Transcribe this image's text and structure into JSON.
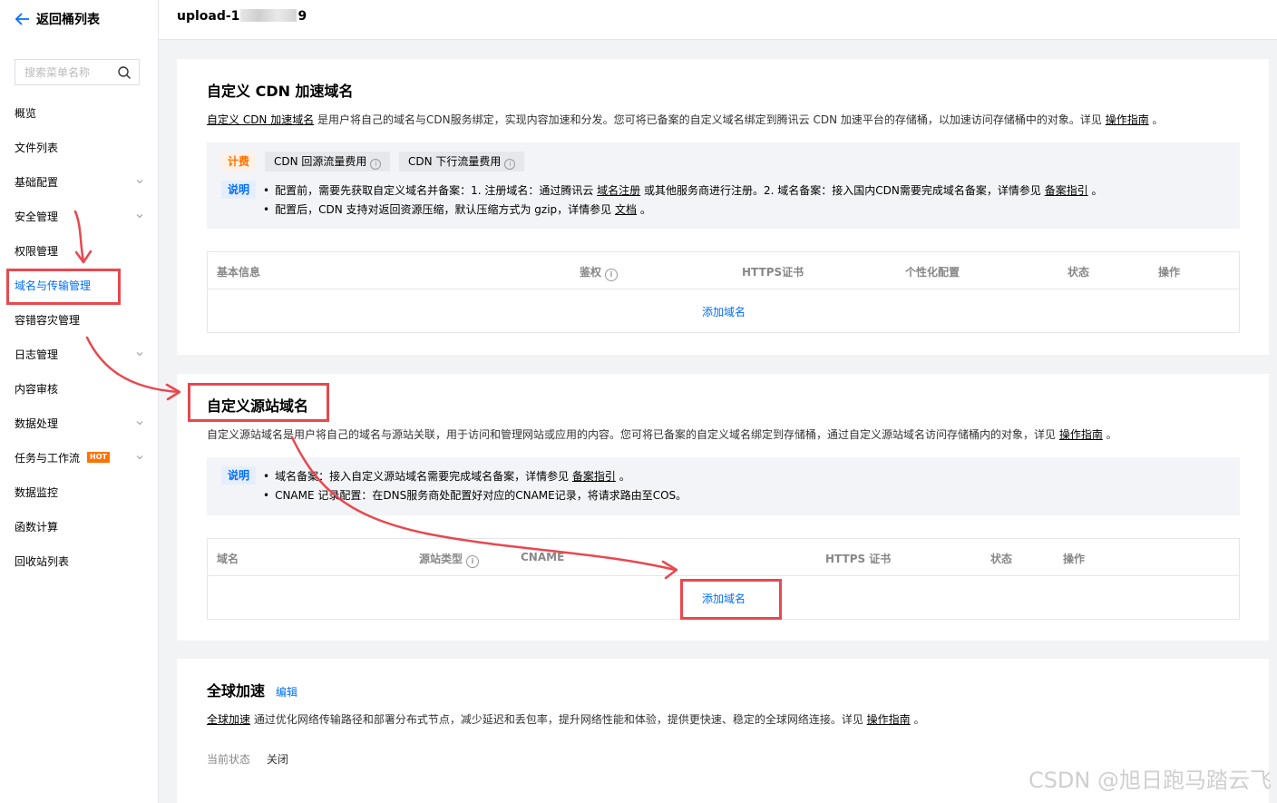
{
  "sidebar": {
    "back_label": "返回桶列表",
    "search_placeholder": "搜索菜单名称",
    "items": [
      {
        "label": "概览"
      },
      {
        "label": "文件列表"
      },
      {
        "label": "基础配置"
      },
      {
        "label": "安全管理"
      },
      {
        "label": "权限管理"
      },
      {
        "label": "域名与传输管理"
      },
      {
        "label": "容错容灾管理"
      },
      {
        "label": "日志管理"
      },
      {
        "label": "内容审核"
      },
      {
        "label": "数据处理"
      },
      {
        "label": "任务与工作流",
        "badge": "HOT"
      },
      {
        "label": "数据监控"
      },
      {
        "label": "函数计算"
      },
      {
        "label": "回收站列表"
      }
    ]
  },
  "topbar": {
    "bucket_prefix": "upload-1",
    "bucket_suffix": "9"
  },
  "cdn": {
    "title": "自定义 CDN 加速域名",
    "desc_link": "自定义 CDN 加速域名",
    "desc_text": " 是用户将自己的域名与CDN服务绑定，实现内容加速和分发。您可将已备案的自定义域名绑定到腾讯云 CDN 加速平台的存储桶，以加速访问存储桶中的对象。详见 ",
    "desc_guide": "操作指南",
    "desc_end": " 。",
    "billing_tag": "计费",
    "fee1": "CDN 回源流量费用",
    "fee2": "CDN 下行流量费用",
    "note_tag": "说明",
    "note1_a": "配置前，需要先获取自定义域名并备案：1. 注册域名：通过腾讯云 ",
    "note1_link1": "域名注册",
    "note1_b": " 或其他服务商进行注册。2. 域名备案：接入国内CDN需要完成域名备案，详情参见 ",
    "note1_link2": "备案指引",
    "note1_end": " 。",
    "note2_a": "配置后，CDN 支持对返回资源压缩，默认压缩方式为 gzip，详情参见 ",
    "note2_link": "文档",
    "note2_end": " 。",
    "columns": [
      "基本信息",
      "鉴权",
      "HTTPS证书",
      "个性化配置",
      "状态",
      "操作"
    ],
    "add_label": "添加域名"
  },
  "origin": {
    "title": "自定义源站域名",
    "desc_text": "自定义源站域名是用户将自己的域名与源站关联，用于访问和管理网站或应用的内容。您可将已备案的自定义域名绑定到存储桶，通过自定义源站域名访问存储桶内的对象，详见 ",
    "desc_guide": "操作指南",
    "desc_end": " 。",
    "note_tag": "说明",
    "note1_a": "域名备案：接入自定义源站域名需要完成域名备案，详情参见 ",
    "note1_link": "备案指引",
    "note1_end": " 。",
    "note2": "CNAME 记录配置：在DNS服务商处配置好对应的CNAME记录，将请求路由至COS。",
    "columns": [
      "域名",
      "源站类型",
      "CNAME",
      "HTTPS 证书",
      "状态",
      "操作"
    ],
    "add_label": "添加域名"
  },
  "global": {
    "title": "全球加速",
    "edit_label": "编辑",
    "desc_link": "全球加速",
    "desc_text": " 通过优化网络传输路径和部署分布式节点，减少延迟和丢包率，提升网络性能和体验，提供更快速、稳定的全球网络连接。详见 ",
    "desc_guide": "操作指南",
    "desc_end": " 。",
    "status_key": "当前状态",
    "status_value": "关闭"
  },
  "watermark": "CSDN @旭日跑马踏云飞",
  "colors": {
    "accent": "#006eff",
    "annotation": "#e8484f",
    "billing": "#ff7200"
  }
}
